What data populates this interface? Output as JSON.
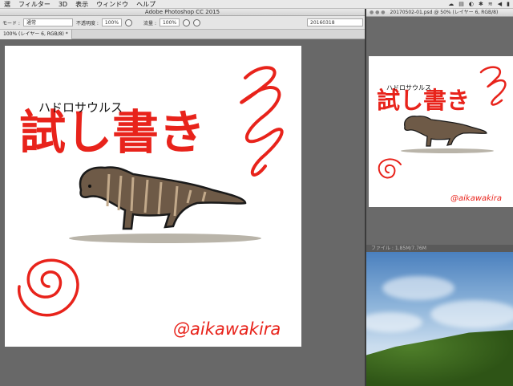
{
  "menubar": {
    "items": [
      "選",
      "フィルター",
      "3D",
      "表示",
      "ウィンドウ",
      "ヘルプ"
    ],
    "status_icons": [
      "☁",
      "▤",
      "◐",
      "✱",
      "≋",
      "◀",
      "▮"
    ]
  },
  "window": {
    "title": "Adobe Photoshop CC 2015"
  },
  "options": {
    "mode_label": "モード :",
    "mode_value": "通常",
    "opacity_label": "不透明度 :",
    "opacity_value": "100%",
    "flow_label": "流量 :",
    "flow_value": "100%",
    "preset_value": "20160318"
  },
  "doc": {
    "tab_label": "100% (レイヤー 6, RGB/8) *"
  },
  "canvas_text": {
    "furigana": "ハドロサウルス",
    "main": "試し書き",
    "signature": "@aikawakira"
  },
  "right_window": {
    "title": "20170502-01.psd @ 50% (レイヤー 6, RGB/8)",
    "status": "ファイル : 1.85M/7.76M"
  },
  "colors": {
    "accent_red": "#e8231b",
    "dino_brown": "#6e5a47",
    "ground": "#b9b4a9"
  }
}
